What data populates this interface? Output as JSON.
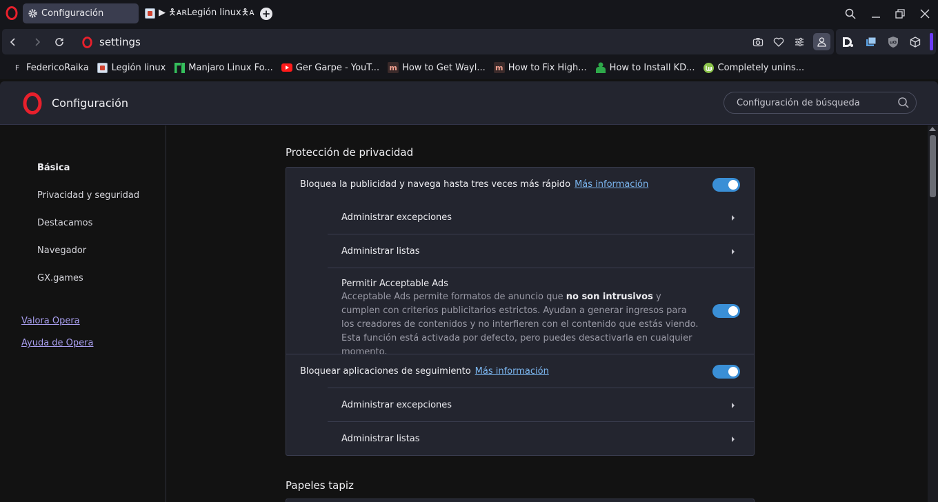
{
  "tabs": [
    {
      "title": "Configuración",
      "icon": "gear-icon",
      "active": true
    },
    {
      "title": "▶ 🯅ᴀʀLegión linux🯅ᴀ",
      "icon": "site-favicon",
      "active": false
    }
  ],
  "address_bar": {
    "url": "settings"
  },
  "bookmarks": [
    {
      "label": "FedericoRaika",
      "icon": "F"
    },
    {
      "label": "Legión linux",
      "icon": "legion-favicon"
    },
    {
      "label": "Manjaro Linux Fo...",
      "icon": "manjaro-icon"
    },
    {
      "label": "Ger Garpe - YouT...",
      "icon": "youtube-icon"
    },
    {
      "label": "How to Get Wayl...",
      "icon": "m"
    },
    {
      "label": "How to Fix High...",
      "icon": "m"
    },
    {
      "label": "How to Install KD...",
      "icon": "person-icon"
    },
    {
      "label": "Completely unins...",
      "icon": "mint-icon"
    }
  ],
  "settings": {
    "title": "Configuración",
    "search_placeholder": "Configuración de búsqueda"
  },
  "sidebar": {
    "items": [
      {
        "label": "Básica",
        "active": true
      },
      {
        "label": "Privacidad y seguridad",
        "active": false
      },
      {
        "label": "Destacamos",
        "active": false
      },
      {
        "label": "Navegador",
        "active": false
      },
      {
        "label": "GX.games",
        "active": false
      }
    ],
    "links": [
      "Valora Opera",
      "Ayuda de Opera"
    ]
  },
  "main": {
    "section1_title": "Protección de privacidad",
    "block_ads": {
      "label": "Bloquea la publicidad y navega hasta tres veces más rápido",
      "link": "Más información",
      "enabled": true
    },
    "manage_exceptions": "Administrar excepciones",
    "manage_lists": "Administrar listas",
    "acceptable_ads": {
      "title": "Permitir Acceptable Ads",
      "desc_pre": "Acceptable Ads permite formatos de anuncio que",
      "desc_bold": "no son intrusivos",
      "desc_post": "y cumplen con criterios publicitarios estrictos. Ayudan a generar ingresos para los creadores de contenidos y no interfieren con el contenido que estás viendo. Esta función está activada por defecto, pero puedes desactivarla en cualquier momento.",
      "enabled": true
    },
    "block_trackers": {
      "label": "Bloquear aplicaciones de seguimiento",
      "link": "Más información",
      "enabled": true
    },
    "section2_title": "Papeles tapiz"
  },
  "colors": {
    "accent_toggle": "#3a8fd6",
    "link": "#7bb6f0",
    "sidebar_link": "#a99ff0",
    "opera_red": "#e8202c"
  }
}
